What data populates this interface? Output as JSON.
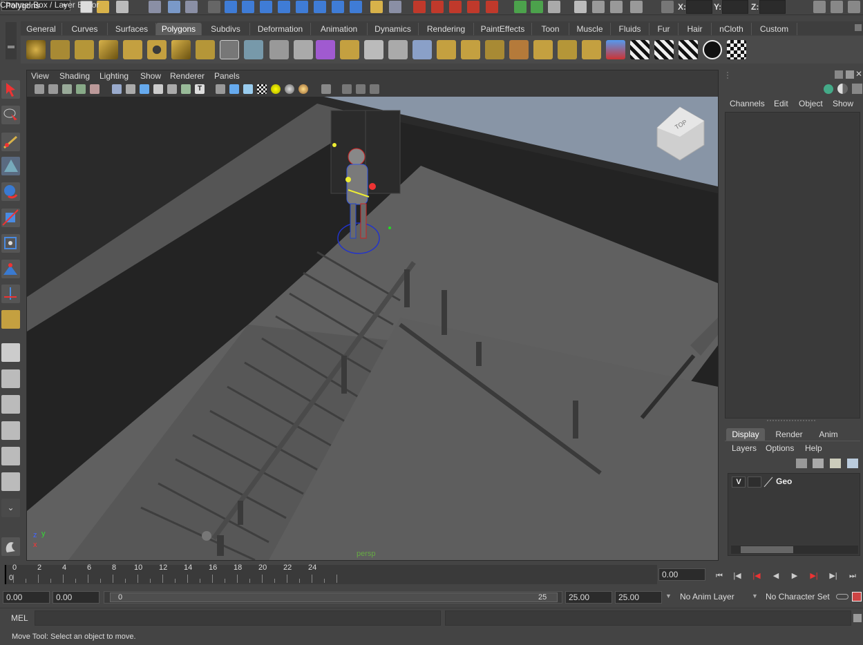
{
  "topbar": {
    "mode_selector": "Polygons",
    "x_label": "X:",
    "y_label": "Y:",
    "z_label": "Z:"
  },
  "shelf": {
    "tabs": [
      "General",
      "Curves",
      "Surfaces",
      "Polygons",
      "Subdivs",
      "Deformation",
      "Animation",
      "Dynamics",
      "Rendering",
      "PaintEffects",
      "Toon",
      "Muscle",
      "Fluids",
      "Fur",
      "Hair",
      "nCloth",
      "Custom"
    ],
    "active_tab": "Polygons"
  },
  "viewport": {
    "menu": [
      "View",
      "Shading",
      "Lighting",
      "Show",
      "Renderer",
      "Panels"
    ],
    "camera_label": "persp",
    "viewcube_label": "TOP",
    "axis_y": "y",
    "axis_x": "x",
    "axis_z": "z"
  },
  "channel_box": {
    "title": "Channel Box / Layer Editor",
    "menu": [
      "Channels",
      "Edit",
      "Object",
      "Show"
    ]
  },
  "layer_editor": {
    "tabs": [
      "Display",
      "Render",
      "Anim"
    ],
    "active_tab": "Display",
    "menu": [
      "Layers",
      "Options",
      "Help"
    ],
    "layers": [
      {
        "visibility": "V",
        "name": "Geo"
      }
    ]
  },
  "timeline": {
    "labels": [
      "0",
      "2",
      "4",
      "6",
      "8",
      "10",
      "12",
      "14",
      "16",
      "18",
      "20",
      "22",
      "24"
    ],
    "current_frame_marker": "0",
    "current_time": "0.00"
  },
  "range": {
    "start_time": "0.00",
    "playback_start": "0.00",
    "slider_start": "0",
    "slider_end": "25",
    "playback_end": "25.00",
    "end_time": "25.00",
    "anim_layer": "No Anim Layer",
    "character_set": "No Character Set"
  },
  "mel": {
    "label": "MEL"
  },
  "status": {
    "text": "Move Tool: Select an object to move."
  }
}
